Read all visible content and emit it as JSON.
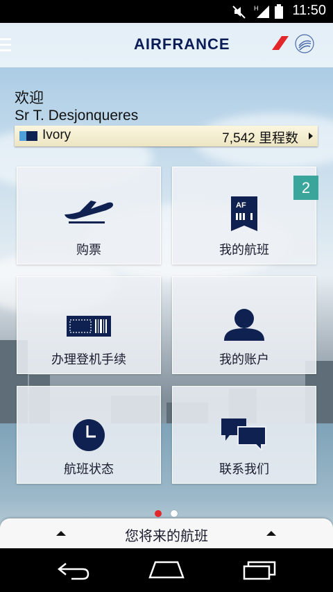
{
  "status_bar": {
    "time": "11:50"
  },
  "header": {
    "brand": "AIRFRANCE"
  },
  "welcome": {
    "greeting": "欢迎",
    "name": "Sr T. Desjonqueres"
  },
  "membership": {
    "tier": "Ivory",
    "miles": "7,542 里程数"
  },
  "tiles": {
    "book": {
      "label": "购票"
    },
    "my_flights": {
      "label": "我的航班",
      "badge": "2",
      "icon_text": "AF"
    },
    "checkin": {
      "label": "办理登机手续"
    },
    "account": {
      "label": "我的账户"
    },
    "flight_status": {
      "label": "航班状态"
    },
    "contact": {
      "label": "联系我们"
    }
  },
  "pager": {
    "current": 1,
    "total": 2
  },
  "drawer": {
    "title": "您将来的航班"
  },
  "colors": {
    "brand_navy": "#0b1d57",
    "badge_teal": "#3aa59b",
    "pager_active": "#e3262a",
    "icon_navy": "#0e2150"
  }
}
